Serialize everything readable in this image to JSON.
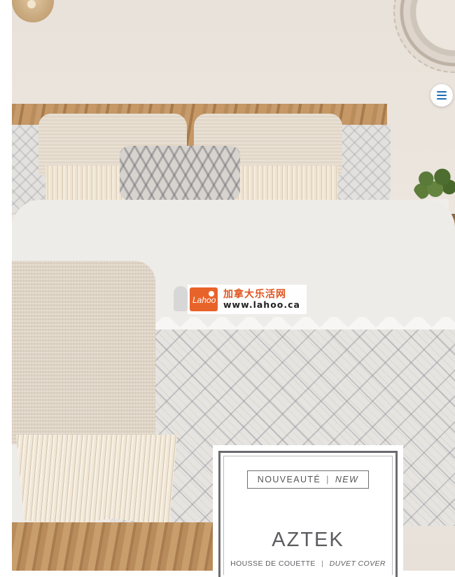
{
  "nav": {
    "menu_icon": "hamburger-menu-icon"
  },
  "watermark": {
    "logo_text": "Lahoo",
    "chinese_name": "加拿大乐活网",
    "url": "www.lahoo.ca"
  },
  "product_card": {
    "badge_fr": "NOUVEAUTÉ",
    "badge_separator": "|",
    "badge_en": "NEW",
    "name": "AZTEK",
    "type_fr": "HOUSSE DE COUETTE",
    "type_separator": "|",
    "type_en": "DUVET COVER"
  },
  "colors": {
    "wall": "#ece6df",
    "headboard_wood": "#b98c5c",
    "card_border": "#6c6c70",
    "watermark_orange": "#e8632a",
    "menu_icon": "#1f6fb5"
  }
}
